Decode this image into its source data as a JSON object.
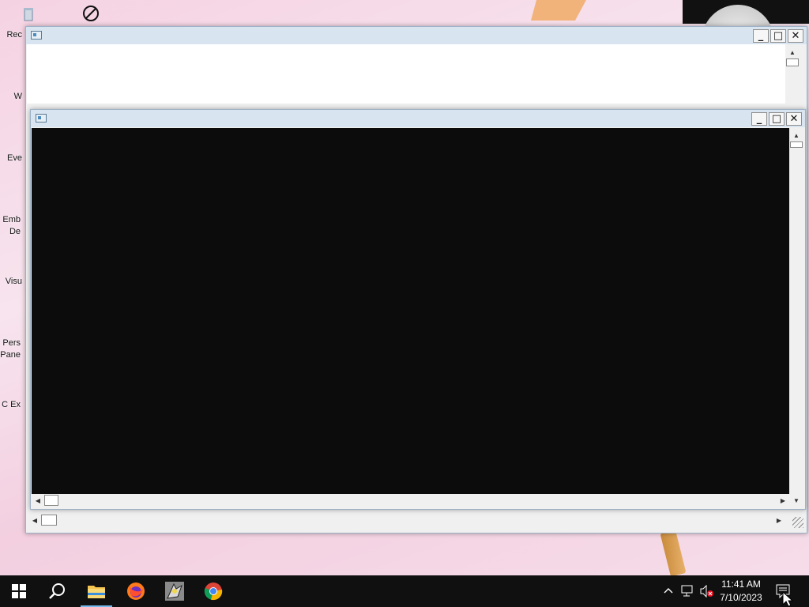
{
  "desktop": {
    "icons": [
      {
        "name": "recycle-bin",
        "label": "Rec"
      },
      {
        "name": "w",
        "label": "W"
      },
      {
        "name": "event",
        "label": "Eve"
      },
      {
        "name": "embedded",
        "label": "Emb De"
      },
      {
        "name": "visual",
        "label": "Visu"
      },
      {
        "name": "personal-panel",
        "label": "Pers Pane"
      },
      {
        "name": "c-ex",
        "label": "C Ex"
      }
    ]
  },
  "windows": [
    {
      "name": "background-window",
      "title": "",
      "buttons": [
        "minimize",
        "maximize",
        "close"
      ]
    },
    {
      "name": "console-window",
      "title": "",
      "buttons": [
        "minimize",
        "maximize",
        "close"
      ]
    }
  ],
  "taskbar": {
    "apps": [
      "start-icon",
      "search-icon",
      "file-explorer-icon",
      "firefox-icon",
      "app-icon",
      "chrome-icon"
    ],
    "active_app": "file-explorer-icon",
    "time": "11:41 AM",
    "date": "7/10/2023"
  },
  "colors": {
    "taskbar": "#101010",
    "console_bg": "#0c0c0c",
    "accent": "#76b9ed"
  }
}
